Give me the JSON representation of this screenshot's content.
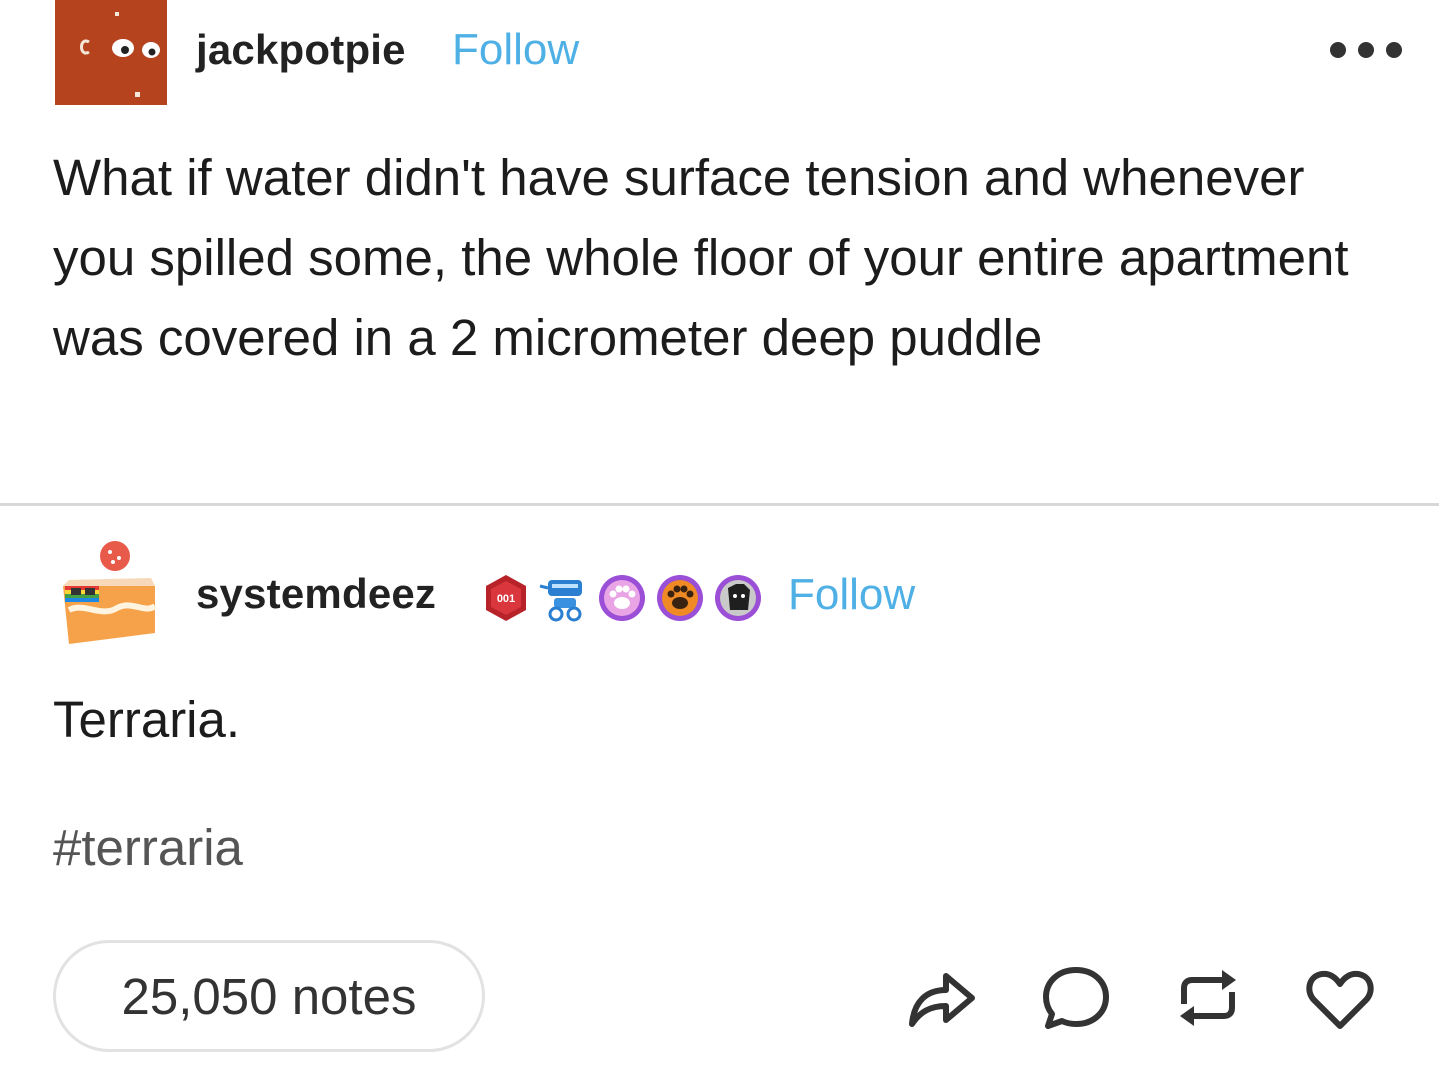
{
  "post": {
    "author": {
      "username": "jackpotpie",
      "follow_label": "Follow",
      "avatar_icon": "cartoon-face-avatar-icon"
    },
    "more_icon": "more-options-icon",
    "body": "What if water didn't have surface tension and whenever you spilled some, the whole floor of your entire apartment was covered in a 2 micrometer deep puddle"
  },
  "reply": {
    "author": {
      "username": "systemdeez",
      "follow_label": "Follow",
      "avatar_icon": "cake-slice-avatar-icon",
      "badge_text": "001",
      "badges": [
        "red-hexagon-badge-icon",
        "blue-robot-badge-icon",
        "purple-paw-badge-icon",
        "orange-paw-badge-icon",
        "gray-dog-badge-icon"
      ]
    },
    "body": "Terraria.",
    "tag": "#terraria"
  },
  "footer": {
    "notes_label": "25,050 notes",
    "actions": [
      "share-icon",
      "comment-icon",
      "reblog-icon",
      "like-icon"
    ]
  },
  "colors": {
    "follow": "#4fb0e6",
    "text": "#1c1c1c",
    "divider": "#d8d8d8",
    "avatar_bg": "#b5431e"
  }
}
